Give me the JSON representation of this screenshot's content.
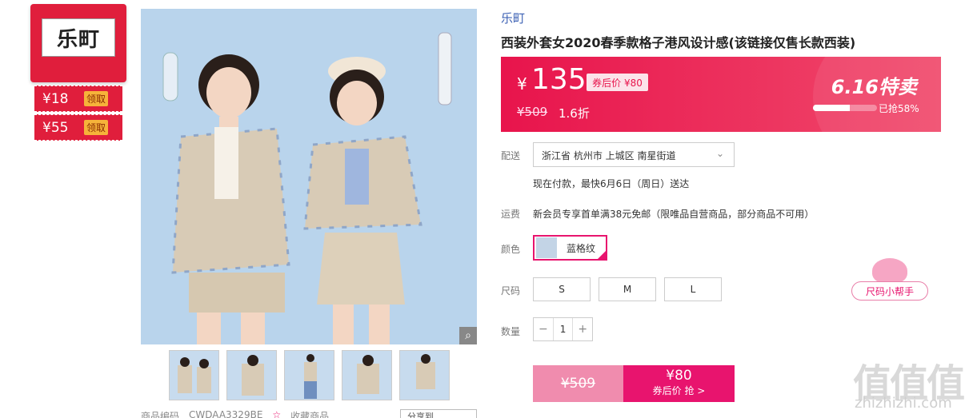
{
  "brand": {
    "logo_text": "乐町",
    "coupons": [
      {
        "amount": "¥18",
        "action": "领取"
      },
      {
        "amount": "¥55",
        "action": "领取"
      }
    ]
  },
  "gallery": {
    "zoom_icon": "magnifier-icon",
    "thumbnail_count": 5,
    "product_code_label": "商品编码",
    "product_code": "CWDAA3329BE",
    "favorite_label": "收藏商品",
    "share_label": "分享到"
  },
  "product": {
    "store": "乐町",
    "title": "西装外套女2020春季款格子港风设计感(该链接仅售长款西装)"
  },
  "price": {
    "currency": "¥",
    "current": "135",
    "coupon_tag": "券后价 ¥80",
    "original": "¥509",
    "discount": "1.6折",
    "promo_title": "6.16特卖",
    "sold_percent": 0.58,
    "sold_text": "已抢58%"
  },
  "delivery": {
    "label": "配送",
    "address": "浙江省 杭州市 上城区 南星街道",
    "eta": "现在付款，最快6月6日（周日）送达"
  },
  "shipping": {
    "label": "运费",
    "text": "新会员专享首单满38元免邮（限唯品自营商品，部分商品不可用）"
  },
  "color": {
    "label": "颜色",
    "selected": "蓝格纹"
  },
  "size": {
    "label": "尺码",
    "options": [
      "S",
      "M",
      "L"
    ],
    "helper": "尺码小帮手"
  },
  "quantity": {
    "label": "数量",
    "minus": "−",
    "value": "1",
    "plus": "+"
  },
  "buy": {
    "original": "¥509",
    "price": "¥80",
    "action": "券后价 抢 >"
  },
  "watermark": {
    "big": "值值值",
    "small": "zhizhizhi.com"
  },
  "colors": {
    "accent": "#e8146e",
    "price_red": "#e01e3c"
  }
}
